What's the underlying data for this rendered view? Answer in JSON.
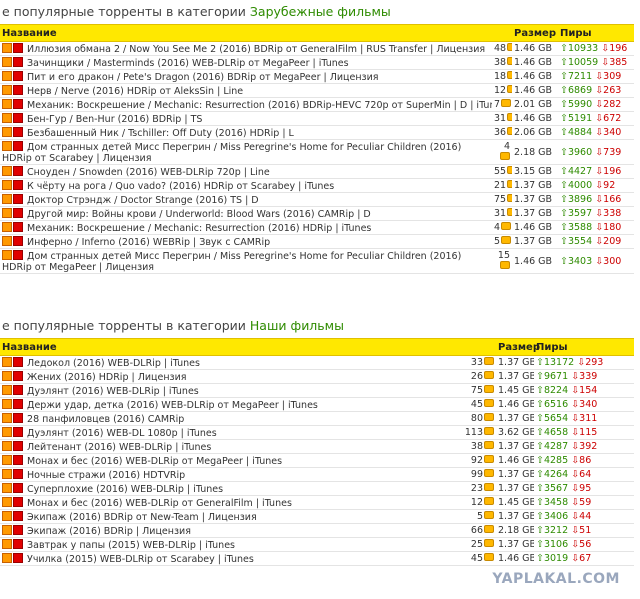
{
  "foreign": {
    "heading_prefix": "е популярные торренты в категории",
    "heading_category": "Зарубежные фильмы",
    "col_name": "Название",
    "col_size": "Размер",
    "col_peers": "Пиры",
    "rows": [
      {
        "title": "Иллюзия обмана 2 / Now You See Me 2 (2016) BDRip от GeneralFilm | RUS Transfer | Лицензия",
        "comments": "48",
        "size": "1.46 GB",
        "seeds": "10933",
        "leech": "196"
      },
      {
        "title": "Зачинщики / Masterminds (2016) WEB-DLRip от MegaPeer | iTunes",
        "comments": "38",
        "size": "1.46 GB",
        "seeds": "10059",
        "leech": "385"
      },
      {
        "title": "Пит и его дракон / Pete's Dragon (2016) BDRip от MegaPeer | Лицензия",
        "comments": "18",
        "size": "1.46 GB",
        "seeds": "7211",
        "leech": "309"
      },
      {
        "title": "Нерв / Nerve (2016) HDRip от AleksSin | Line",
        "comments": "12",
        "size": "1.46 GB",
        "seeds": "6869",
        "leech": "263"
      },
      {
        "title": "Механик: Воскрешение / Mechanic: Resurrection (2016) BDRip-HEVC 720p от SuperMin | D | iTunes",
        "comments": "7",
        "size": "2.01 GB",
        "seeds": "5990",
        "leech": "282"
      },
      {
        "title": "Бен-Гур / Ben-Hur (2016) BDRip | TS",
        "comments": "31",
        "size": "1.46 GB",
        "seeds": "5191",
        "leech": "672"
      },
      {
        "title": "Безбашенный Ник / Tschiller: Off Duty (2016) HDRip | L",
        "comments": "36",
        "size": "2.06 GB",
        "seeds": "4884",
        "leech": "340"
      },
      {
        "title": "Дом странных детей Мисс Перегрин / Miss Peregrine's Home for Peculiar Children (2016) HDRip от Scarabey | Лицензия",
        "comments": "4",
        "size": "2.18 GB",
        "seeds": "3960",
        "leech": "739",
        "tall": true
      },
      {
        "title": "Сноуден / Snowden (2016) WEB-DLRip 720p | Line",
        "comments": "55",
        "size": "3.15 GB",
        "seeds": "4427",
        "leech": "196"
      },
      {
        "title": "К чёрту на рога / Quo vado? (2016) HDRip от Scarabey | iTunes",
        "comments": "21",
        "size": "1.37 GB",
        "seeds": "4000",
        "leech": "92"
      },
      {
        "title": "Доктор Стрэндж / Doctor Strange (2016) TS | D",
        "comments": "75",
        "size": "1.37 GB",
        "seeds": "3896",
        "leech": "166"
      },
      {
        "title": "Другой мир: Войны крови / Underworld: Blood Wars (2016) CAMRip | D",
        "comments": "31",
        "size": "1.37 GB",
        "seeds": "3597",
        "leech": "338"
      },
      {
        "title": "Механик: Воскрешение / Mechanic: Resurrection (2016) HDRip | iTunes",
        "comments": "4",
        "size": "1.46 GB",
        "seeds": "3588",
        "leech": "180"
      },
      {
        "title": "Инферно / Inferno (2016) WEBRip | Звук с CAMRip",
        "comments": "5",
        "size": "1.37 GB",
        "seeds": "3554",
        "leech": "209"
      },
      {
        "title": "Дом странных детей Мисс Перегрин / Miss Peregrine's Home for Peculiar Children (2016) HDRip от MegaPeer | Лицензия",
        "comments": "15",
        "size": "1.46 GB",
        "seeds": "3403",
        "leech": "300",
        "tall": true
      }
    ]
  },
  "ours": {
    "heading_prefix": "е популярные торренты в категории",
    "heading_category": "Наши фильмы",
    "col_name": "Название",
    "col_size": "Размер",
    "col_peers": "Пиры",
    "rows": [
      {
        "title": "Ледокол (2016) WEB-DLRip | iTunes",
        "comments": "33",
        "size": "1.37 GB",
        "seeds": "13172",
        "leech": "293"
      },
      {
        "title": "Жених (2016) HDRip | Лицензия",
        "comments": "26",
        "size": "1.37 GB",
        "seeds": "9671",
        "leech": "339"
      },
      {
        "title": "Дуэлянт (2016) WEB-DLRip | iTunes",
        "comments": "75",
        "size": "1.45 GB",
        "seeds": "8224",
        "leech": "154"
      },
      {
        "title": "Держи удар, детка (2016) WEB-DLRip от MegaPeer | iTunes",
        "comments": "45",
        "size": "1.46 GB",
        "seeds": "6516",
        "leech": "340"
      },
      {
        "title": "28 панфиловцев (2016) CAMRip",
        "comments": "80",
        "size": "1.37 GB",
        "seeds": "5654",
        "leech": "311"
      },
      {
        "title": "Дуэлянт (2016) WEB-DL 1080p | iTunes",
        "comments": "113",
        "size": "3.62 GB",
        "seeds": "4658",
        "leech": "115"
      },
      {
        "title": "Лейтенант (2016) WEB-DLRip | iTunes",
        "comments": "38",
        "size": "1.37 GB",
        "seeds": "4287",
        "leech": "392"
      },
      {
        "title": "Монах и бес (2016) WEB-DLRip от MegaPeer | iTunes",
        "comments": "92",
        "size": "1.46 GB",
        "seeds": "4285",
        "leech": "86"
      },
      {
        "title": "Ночные стражи (2016) HDTVRip",
        "comments": "99",
        "size": "1.37 GB",
        "seeds": "4264",
        "leech": "64"
      },
      {
        "title": "Суперплохие (2016) WEB-DLRip | iTunes",
        "comments": "23",
        "size": "1.37 GB",
        "seeds": "3567",
        "leech": "95"
      },
      {
        "title": "Монах и бес (2016) WEB-DLRip от GeneralFilm | iTunes",
        "comments": "12",
        "size": "1.45 GB",
        "seeds": "3458",
        "leech": "59"
      },
      {
        "title": "Экипаж (2016) BDRip от New-Team | Лицензия",
        "comments": "5",
        "size": "1.37 GB",
        "seeds": "3406",
        "leech": "44"
      },
      {
        "title": "Экипаж (2016) BDRip | Лицензия",
        "comments": "66",
        "size": "2.18 GB",
        "seeds": "3212",
        "leech": "51"
      },
      {
        "title": "Завтрак у папы (2015) WEB-DLRip | iTunes",
        "comments": "25",
        "size": "1.37 GB",
        "seeds": "3106",
        "leech": "56"
      },
      {
        "title": "Училка (2015) WEB-DLRip от Scarabey | iTunes",
        "comments": "45",
        "size": "1.46 GB",
        "seeds": "3019",
        "leech": "67"
      }
    ]
  },
  "watermark": "YAPLAKAL.COM",
  "colors": {
    "header_bg": "#ffe800",
    "seed": "#2e8b00",
    "leech": "#cc0000",
    "category": "#2e8b00"
  }
}
